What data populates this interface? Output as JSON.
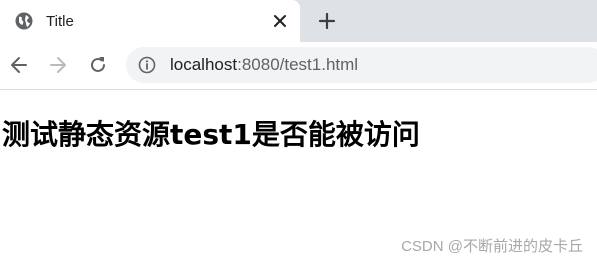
{
  "tab": {
    "title": "Title"
  },
  "address_bar": {
    "host": "localhost",
    "path": ":8080/test1.html"
  },
  "page": {
    "heading": "测试静态资源test1是否能被访问"
  },
  "watermark": "CSDN @不断前进的皮卡丘"
}
